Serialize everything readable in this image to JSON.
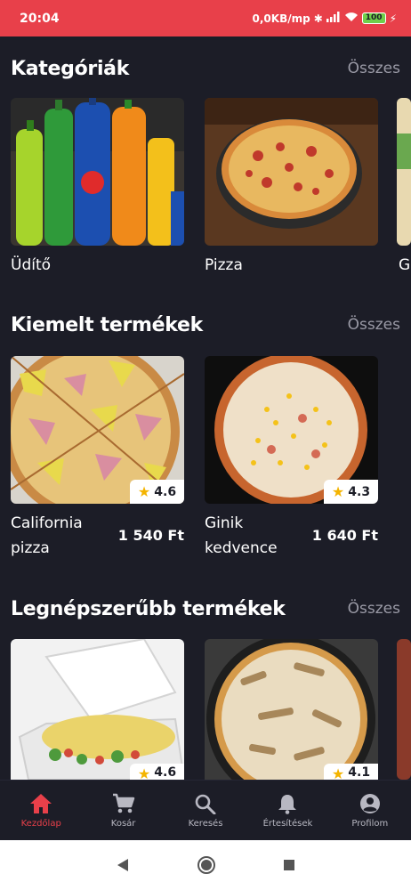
{
  "status_bar": {
    "time": "20:04",
    "speed": "0,0KB/mp",
    "battery": "100"
  },
  "categories": {
    "title": "Kategóriák",
    "all_label": "Összes",
    "items": [
      {
        "label": "Üdítő"
      },
      {
        "label": "Pizza"
      },
      {
        "label": "G"
      }
    ]
  },
  "featured": {
    "title": "Kiemelt termékek",
    "all_label": "Összes",
    "items": [
      {
        "name": "California pizza",
        "price": "1 540 Ft",
        "rating": "4.6"
      },
      {
        "name": "Ginik kedvence",
        "price": "1 640 Ft",
        "rating": "4.3"
      }
    ]
  },
  "popular": {
    "title": "Legnépszerűbb termékek",
    "all_label": "Összes",
    "items": [
      {
        "rating": "4.6"
      },
      {
        "rating": "4.1"
      }
    ]
  },
  "bottom_nav": {
    "items": [
      {
        "label": "Kezdőlap",
        "icon": "home-icon",
        "active": true
      },
      {
        "label": "Kosár",
        "icon": "cart-icon"
      },
      {
        "label": "Keresés",
        "icon": "search-icon"
      },
      {
        "label": "Értesítések",
        "icon": "bell-icon"
      },
      {
        "label": "Profilom",
        "icon": "profile-icon"
      }
    ]
  },
  "colors": {
    "accent": "#e8404a",
    "background": "#1c1d27",
    "muted": "#9a9aa6",
    "star": "#f4b400"
  }
}
